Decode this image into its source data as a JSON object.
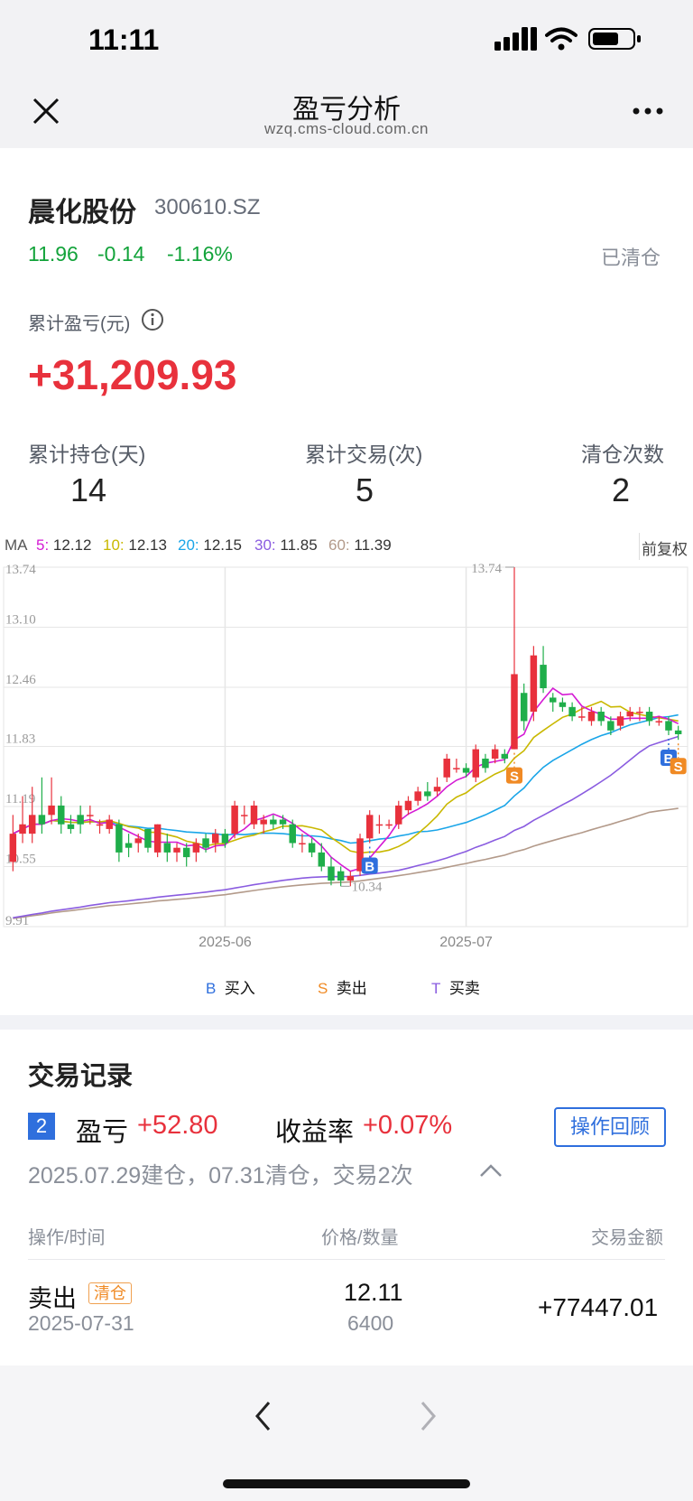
{
  "status_bar": {
    "time": "11:11"
  },
  "nav": {
    "title": "盈亏分析",
    "url": "wzq.cms-cloud.com.cn"
  },
  "stock": {
    "name": "晨化股份",
    "code": "300610.SZ",
    "price": "11.96",
    "change": "-0.14",
    "change_pct": "-1.16%",
    "status": "已清仓"
  },
  "pnl": {
    "label": "累计盈亏(元)",
    "value": "+31,209.93"
  },
  "stats": [
    {
      "label": "累计持仓(天)",
      "value": "14"
    },
    {
      "label": "累计交易(次)",
      "value": "5"
    },
    {
      "label": "清仓次数",
      "value": "2"
    }
  ],
  "ma": {
    "prefix": "MA",
    "items": [
      {
        "key": "5:",
        "value": "12.12",
        "color": "#d41ad4"
      },
      {
        "key": "10:",
        "value": "12.13",
        "color": "#c9b800"
      },
      {
        "key": "20:",
        "value": "12.15",
        "color": "#1aa5e8"
      },
      {
        "key": "30:",
        "value": "11.85",
        "color": "#8a5ce0"
      },
      {
        "key": "60:",
        "value": "11.39",
        "color": "#b39a8a"
      }
    ],
    "adjust": "前复权"
  },
  "chart_data": {
    "type": "candlestick",
    "y_ticks": [
      "13.74",
      "13.10",
      "12.46",
      "11.83",
      "11.19",
      "10.55",
      "9.91"
    ],
    "ylim": [
      9.91,
      13.74
    ],
    "x_labels": [
      "2025-06",
      "2025-07"
    ],
    "annotations": {
      "high": "13.74",
      "low": "10.34"
    },
    "candles": [
      [
        10.6,
        10.9,
        10.5,
        11.1
      ],
      [
        10.9,
        11.0,
        10.8,
        11.3
      ],
      [
        10.9,
        11.1,
        10.8,
        11.4
      ],
      [
        11.1,
        11.0,
        10.9,
        11.5
      ],
      [
        11.1,
        11.2,
        11.0,
        11.5
      ],
      [
        11.2,
        11.0,
        10.9,
        11.3
      ],
      [
        11.0,
        10.95,
        10.9,
        11.1
      ],
      [
        11.1,
        11.0,
        10.9,
        11.2
      ],
      [
        11.1,
        11.1,
        11.0,
        11.2
      ],
      [
        11.0,
        11.0,
        10.9,
        11.05
      ],
      [
        10.95,
        11.05,
        10.9,
        11.1
      ],
      [
        11.0,
        10.7,
        10.6,
        11.05
      ],
      [
        10.8,
        10.75,
        10.65,
        10.9
      ],
      [
        10.8,
        10.85,
        10.7,
        10.9
      ],
      [
        10.95,
        10.75,
        10.7,
        10.95
      ],
      [
        10.7,
        11.0,
        10.65,
        11.0
      ],
      [
        10.8,
        10.7,
        10.6,
        10.9
      ],
      [
        10.7,
        10.75,
        10.6,
        10.8
      ],
      [
        10.75,
        10.65,
        10.55,
        10.8
      ],
      [
        10.7,
        10.8,
        10.6,
        10.85
      ],
      [
        10.85,
        10.75,
        10.7,
        10.9
      ],
      [
        10.8,
        10.9,
        10.7,
        10.95
      ],
      [
        10.9,
        10.8,
        10.75,
        10.95
      ],
      [
        10.9,
        11.2,
        10.85,
        11.25
      ],
      [
        11.1,
        11.1,
        11.0,
        11.2
      ],
      [
        11.0,
        11.2,
        10.95,
        11.25
      ],
      [
        11.0,
        11.05,
        10.9,
        11.1
      ],
      [
        11.05,
        11.0,
        10.95,
        11.1
      ],
      [
        11.05,
        11.0,
        10.95,
        11.1
      ],
      [
        11.0,
        10.8,
        10.75,
        11.05
      ],
      [
        10.8,
        10.8,
        10.7,
        10.9
      ],
      [
        10.8,
        10.7,
        10.65,
        10.85
      ],
      [
        10.7,
        10.55,
        10.5,
        10.8
      ],
      [
        10.55,
        10.4,
        10.35,
        10.65
      ],
      [
        10.5,
        10.4,
        10.34,
        10.55
      ],
      [
        10.4,
        10.45,
        10.34,
        10.5
      ],
      [
        10.5,
        10.85,
        10.45,
        10.9
      ],
      [
        10.85,
        11.1,
        10.8,
        11.15
      ],
      [
        11.0,
        11.0,
        10.9,
        11.1
      ],
      [
        11.0,
        11.0,
        10.95,
        11.05
      ],
      [
        11.0,
        11.2,
        10.95,
        11.25
      ],
      [
        11.15,
        11.25,
        11.1,
        11.3
      ],
      [
        11.25,
        11.35,
        11.2,
        11.4
      ],
      [
        11.35,
        11.3,
        11.25,
        11.45
      ],
      [
        11.35,
        11.4,
        11.3,
        11.5
      ],
      [
        11.5,
        11.7,
        11.45,
        11.75
      ],
      [
        11.6,
        11.6,
        11.55,
        11.7
      ],
      [
        11.6,
        11.55,
        11.5,
        11.65
      ],
      [
        11.5,
        11.8,
        11.45,
        11.85
      ],
      [
        11.7,
        11.6,
        11.55,
        11.75
      ],
      [
        11.7,
        11.8,
        11.65,
        11.85
      ],
      [
        11.75,
        11.7,
        11.65,
        11.8
      ],
      [
        11.8,
        12.6,
        11.8,
        13.74
      ],
      [
        12.4,
        12.1,
        12.0,
        12.5
      ],
      [
        12.2,
        12.8,
        12.1,
        12.9
      ],
      [
        12.7,
        12.45,
        12.4,
        12.9
      ],
      [
        12.35,
        12.3,
        12.2,
        12.4
      ],
      [
        12.3,
        12.25,
        12.2,
        12.35
      ],
      [
        12.25,
        12.15,
        12.1,
        12.3
      ],
      [
        12.15,
        12.15,
        12.1,
        12.25
      ],
      [
        12.1,
        12.2,
        12.05,
        12.25
      ],
      [
        12.2,
        12.1,
        12.05,
        12.25
      ],
      [
        12.1,
        12.0,
        11.95,
        12.15
      ],
      [
        12.05,
        12.15,
        12.0,
        12.2
      ],
      [
        12.15,
        12.2,
        12.1,
        12.25
      ],
      [
        12.2,
        12.2,
        12.1,
        12.25
      ],
      [
        12.2,
        12.1,
        12.05,
        12.25
      ],
      [
        12.1,
        12.1,
        12.05,
        12.15
      ],
      [
        12.1,
        12.0,
        11.95,
        12.15
      ],
      [
        12.0,
        11.96,
        11.9,
        12.05
      ]
    ],
    "markers": [
      {
        "type": "S",
        "index": 52,
        "label": "S"
      },
      {
        "type": "B",
        "index": 37,
        "label": "B"
      },
      {
        "type": "B",
        "index": 68,
        "label": "B"
      },
      {
        "type": "S",
        "index": 69,
        "label": "S"
      }
    ],
    "legend": [
      {
        "symbol": "B",
        "label": "买入",
        "color": "#2f6fdd"
      },
      {
        "symbol": "S",
        "label": "卖出",
        "color": "#f08a24"
      },
      {
        "symbol": "T",
        "label": "买卖",
        "color": "#8a5ce0"
      }
    ]
  },
  "trade_section": {
    "title": "交易记录",
    "index": "2",
    "pnl_label": "盈亏",
    "pnl_value": "+52.80",
    "rate_label": "收益率",
    "rate_value": "+0.07%",
    "review_button": "操作回顾",
    "summary": "2025.07.29建仓，07.31清仓，交易2次",
    "headers": {
      "op_time": "操作/时间",
      "price_qty": "价格/数量",
      "amount": "交易金额"
    },
    "row": {
      "op": "卖出",
      "badge": "清仓",
      "date": "2025-07-31",
      "price": "12.11",
      "qty": "6400",
      "amount": "+77447.01"
    }
  }
}
